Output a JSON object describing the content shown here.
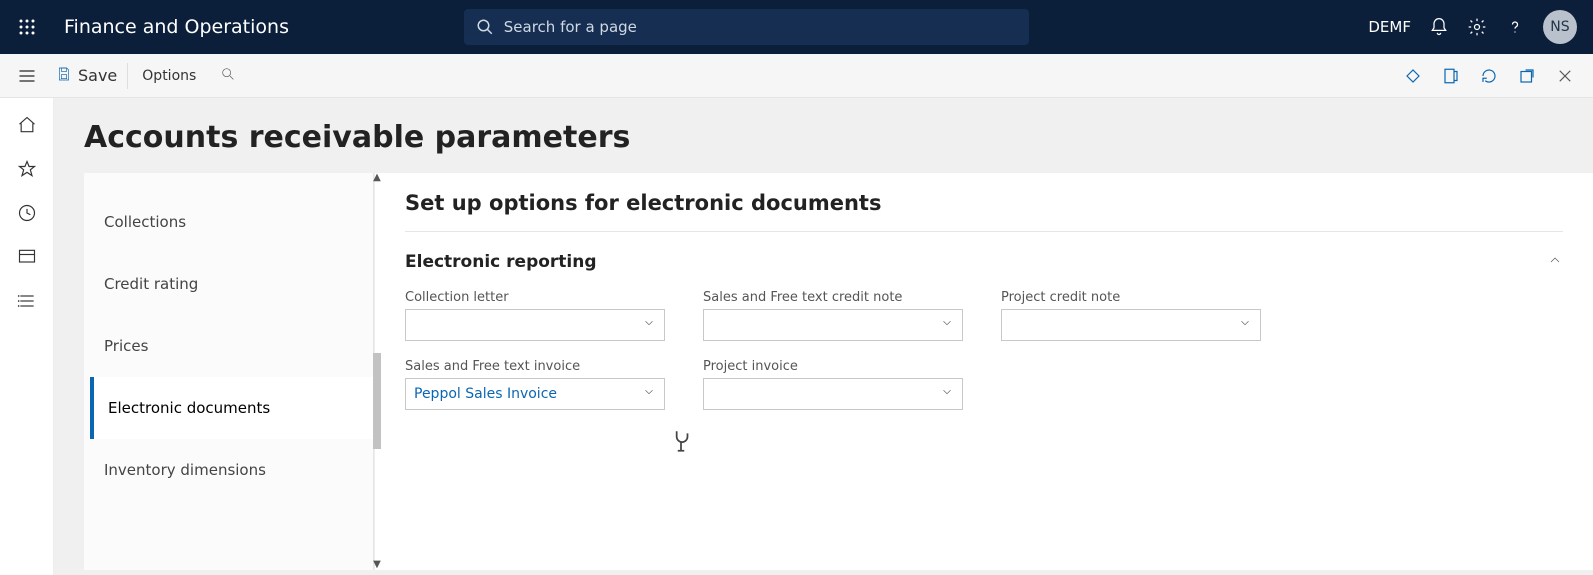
{
  "header": {
    "app_title": "Finance and Operations",
    "search_placeholder": "Search for a page",
    "environment": "DEMF",
    "avatar_initials": "NS"
  },
  "actionbar": {
    "save_label": "Save",
    "options_label": "Options"
  },
  "page": {
    "title": "Accounts receivable parameters"
  },
  "nav": {
    "items": [
      "Collections",
      "Credit rating",
      "Prices",
      "Electronic documents",
      "Inventory dimensions"
    ],
    "active_index": 3
  },
  "detail": {
    "title": "Set up options for electronic documents",
    "section_title": "Electronic reporting",
    "fields": {
      "collection_letter": {
        "label": "Collection letter",
        "value": ""
      },
      "sales_credit_note": {
        "label": "Sales and Free text credit note",
        "value": ""
      },
      "project_credit_note": {
        "label": "Project credit note",
        "value": ""
      },
      "sales_invoice": {
        "label": "Sales and Free text invoice",
        "value": "Peppol Sales Invoice"
      },
      "project_invoice": {
        "label": "Project invoice",
        "value": ""
      }
    }
  }
}
